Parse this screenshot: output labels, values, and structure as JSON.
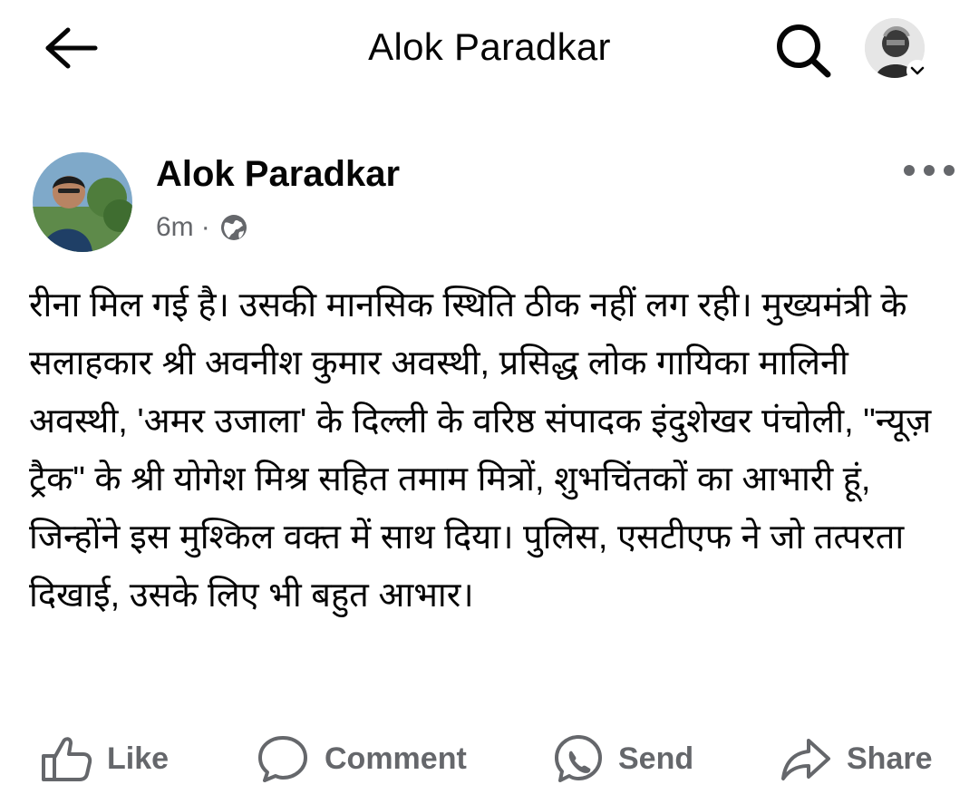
{
  "header": {
    "title": "Alok Paradkar",
    "back_icon": "arrow-left-icon",
    "search_icon": "search-icon",
    "profile_icon": "avatar",
    "chevron_icon": "chevron-down-icon"
  },
  "post": {
    "author": "Alok Paradkar",
    "time": "6m",
    "separator": "·",
    "audience_icon": "globe-icon",
    "more_icon": "more-horizontal-icon",
    "body": "रीना मिल गई है। उसकी मानसिक स्थिति ठीक नहीं लग रही। मुख्यमंत्री के सलाहकार श्री अवनीश कुमार अवस्थी, प्रसिद्ध लोक गायिका मालिनी अवस्थी, 'अमर उजाला' के दिल्ली के वरिष्ठ संपादक इंदुशेखर पंचोली, \"न्यूज़ ट्रैक\" के श्री योगेश मिश्र सहित तमाम मित्रों, शुभचिंतकों का आभारी हूं, जिन्होंने इस मुश्किल वक्त में साथ दिया। पुलिस, एसटीएफ ने जो तत्परता दिखाई, उसके लिए भी बहुत आभार।"
  },
  "actions": {
    "like": "Like",
    "comment": "Comment",
    "send": "Send",
    "share": "Share"
  },
  "colors": {
    "text": "#050505",
    "secondary": "#65676b",
    "background": "#ffffff"
  }
}
